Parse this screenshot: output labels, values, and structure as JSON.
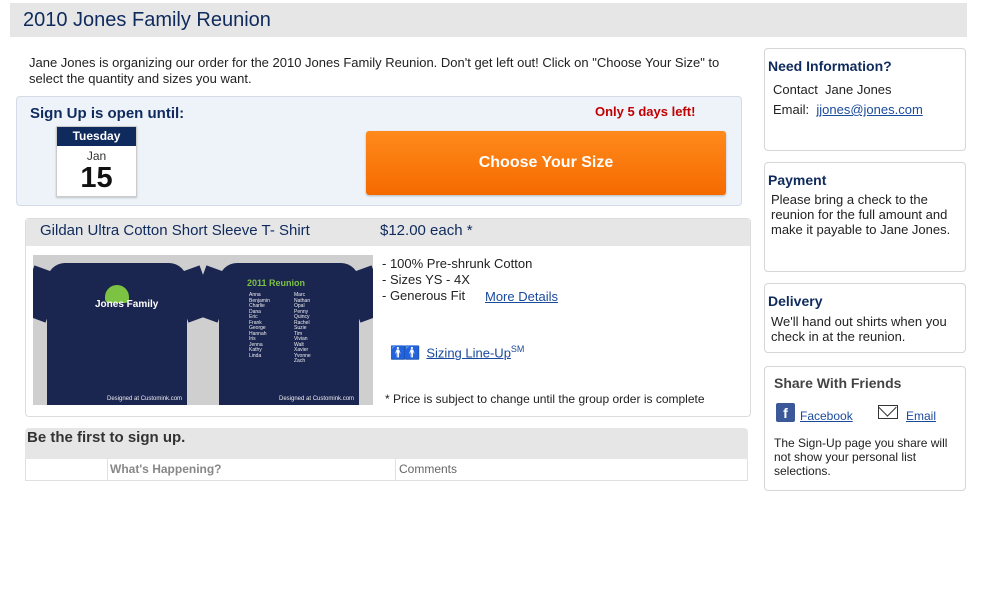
{
  "page": {
    "title": "2010 Jones Family Reunion",
    "intro": "Jane Jones is organizing our order for the 2010 Jones Family Reunion.    Don't get left out!  Click on  \"Choose Your Size\" to select the quantity and sizes you want."
  },
  "signup": {
    "label": "Sign Up is open until:",
    "days_left": "Only 5 days left!",
    "calendar": {
      "weekday": "Tuesday",
      "month": "Jan",
      "day": "15"
    },
    "button_label": "Choose Your Size"
  },
  "product": {
    "name": "Gildan Ultra Cotton Short Sleeve T- Shirt",
    "price": "$12.00 each *",
    "features": [
      "- 100% Pre-shrunk Cotton",
      "- Sizes YS - 4X",
      "- Generous Fit"
    ],
    "more_details": "More Details",
    "sizing_label": "Sizing Line-Up",
    "sizing_sup": "SM",
    "price_note": "* Price is subject to change until the group order is complete",
    "image": {
      "front_logo": "Jones Family",
      "back_title": "2011 Reunion",
      "names_left": [
        "Anna",
        "Benjamin",
        "Charlie",
        "Dana",
        "Eric",
        "Frank",
        "George",
        "Hannah",
        "Iris",
        "Jenna",
        "Kathy",
        "Linda"
      ],
      "names_right": [
        "Marc",
        "Nathan",
        "Opal",
        "Penny",
        "Quincy",
        "Rachel",
        "Suzie",
        "Tim",
        "Vivian",
        "Walt",
        "Xavier",
        "Yvonne",
        "Zach"
      ],
      "credit_front": "Designed at Customink.com",
      "credit_back": "Designed at Customink.com"
    }
  },
  "activity": {
    "title": "Be the first to sign up.",
    "col_happening": "What's Happening?",
    "col_comments": "Comments"
  },
  "sidebar": {
    "info": {
      "title": "Need Information?",
      "contact_label": "Contact",
      "contact_name": "Jane Jones",
      "email_label": "Email:",
      "email": "jjones@jones.com"
    },
    "payment": {
      "title": "Payment",
      "text": "Please bring a check to the reunion for the full amount and make it payable to Jane Jones."
    },
    "delivery": {
      "title": "Delivery",
      "text": "We'll hand out shirts when you check in at the reunion."
    },
    "share": {
      "title": "Share With Friends",
      "facebook": "Facebook",
      "email": "Email",
      "note": "The Sign-Up page you share will not show your personal  list selections."
    }
  },
  "colors": {
    "brand_navy": "#0f2a5c",
    "cta_orange": "#f57a0e",
    "alert_red": "#c00000",
    "link_blue": "#1a4a9c"
  },
  "icons": [
    "calendar-icon",
    "people-icon",
    "facebook-icon",
    "mail-icon"
  ]
}
